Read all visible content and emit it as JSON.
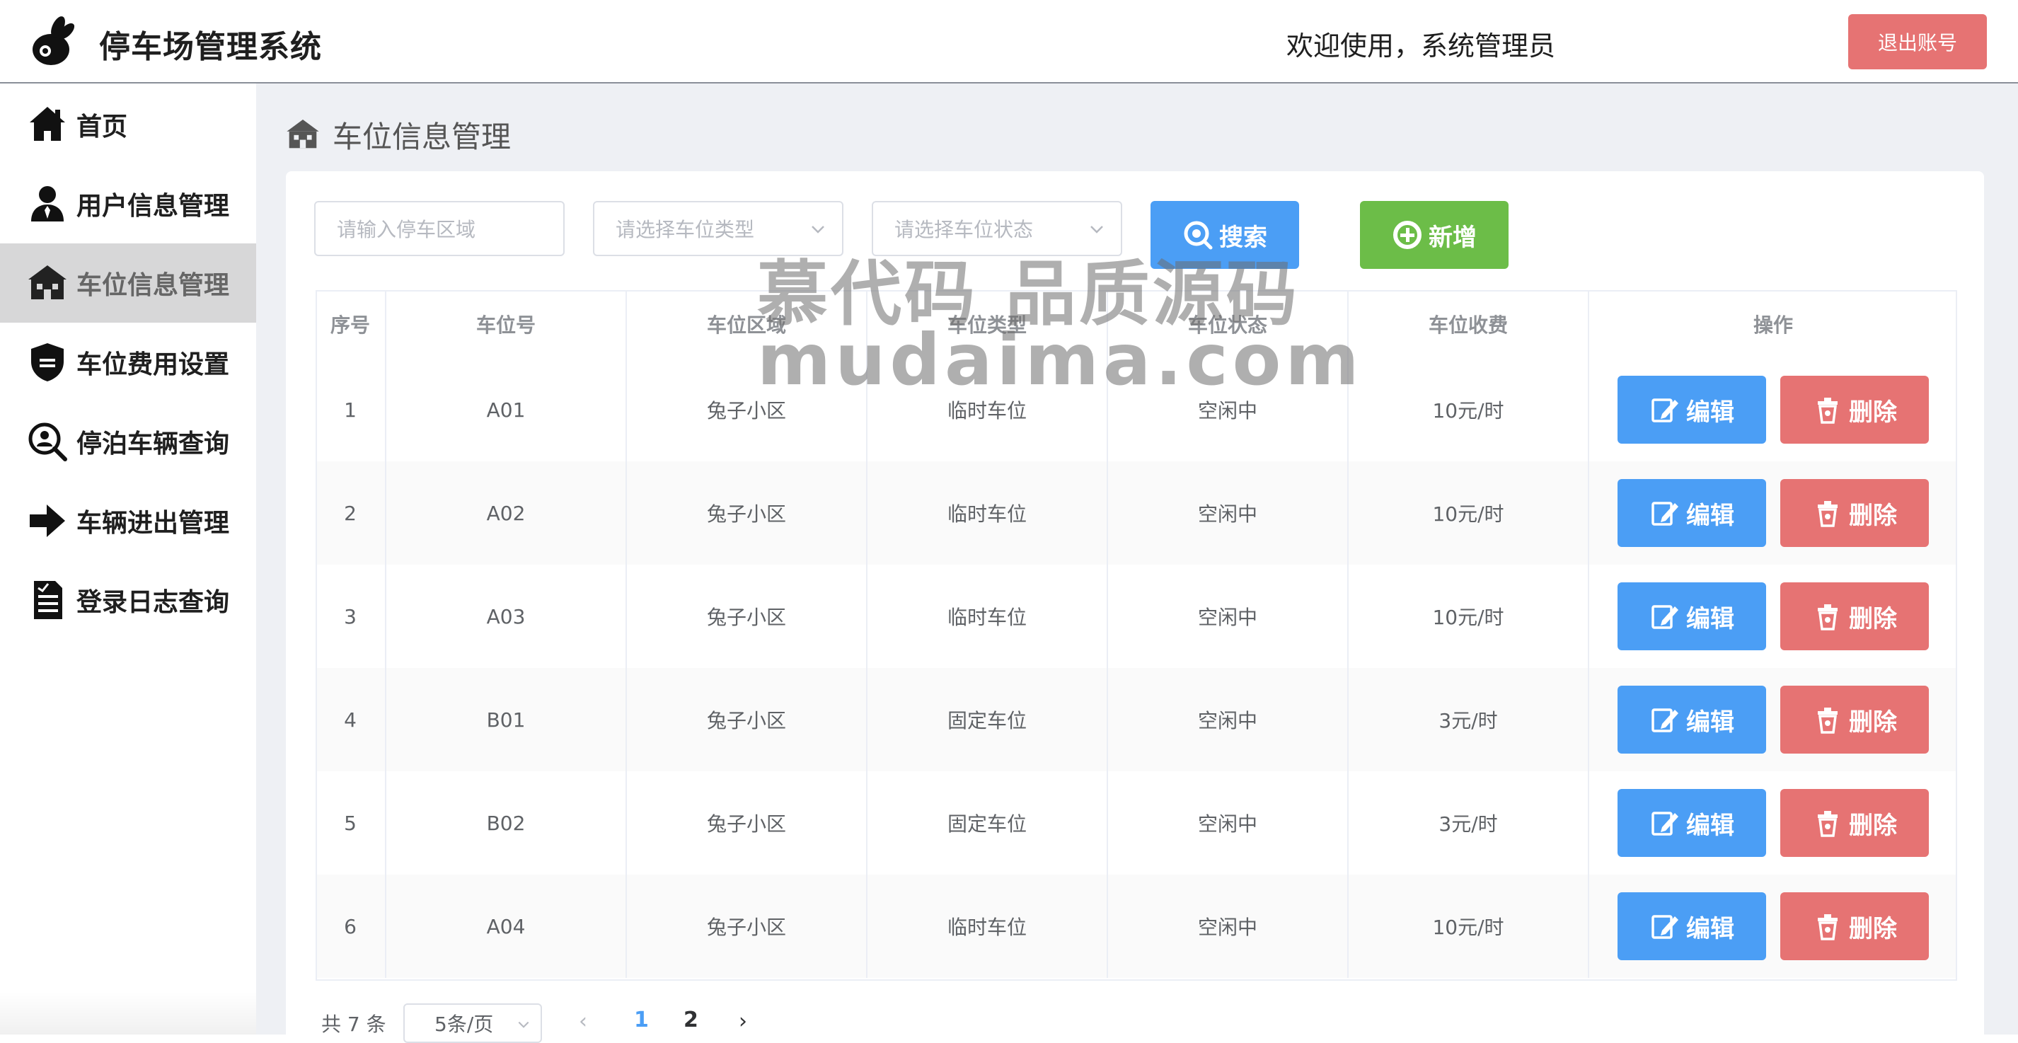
{
  "header": {
    "app_title": "停车场管理系统",
    "welcome": "欢迎使用，系统管理员",
    "logout_label": "退出账号"
  },
  "sidebar": {
    "items": [
      {
        "label": "首页",
        "icon": "home-icon"
      },
      {
        "label": "用户信息管理",
        "icon": "user-icon"
      },
      {
        "label": "车位信息管理",
        "icon": "parking-icon"
      },
      {
        "label": "车位费用设置",
        "icon": "shield-money-icon"
      },
      {
        "label": "停泊车辆查询",
        "icon": "search-person-icon"
      },
      {
        "label": "车辆进出管理",
        "icon": "arrow-right-icon"
      },
      {
        "label": "登录日志查询",
        "icon": "document-icon"
      }
    ],
    "active_index": 2
  },
  "page": {
    "title": "车位信息管理"
  },
  "filters": {
    "area_placeholder": "请输入停车区域",
    "type_placeholder": "请选择车位类型",
    "status_placeholder": "请选择车位状态",
    "search_label": "搜索",
    "add_label": "新增"
  },
  "table": {
    "headers": [
      "序号",
      "车位号",
      "车位区域",
      "车位类型",
      "车位状态",
      "车位收费",
      "操作"
    ],
    "rows": [
      [
        "1",
        "A01",
        "兔子小区",
        "临时车位",
        "空闲中",
        "10元/时"
      ],
      [
        "2",
        "A02",
        "兔子小区",
        "临时车位",
        "空闲中",
        "10元/时"
      ],
      [
        "3",
        "A03",
        "兔子小区",
        "临时车位",
        "空闲中",
        "10元/时"
      ],
      [
        "4",
        "B01",
        "兔子小区",
        "固定车位",
        "空闲中",
        "3元/时"
      ],
      [
        "5",
        "B02",
        "兔子小区",
        "固定车位",
        "空闲中",
        "3元/时"
      ],
      [
        "6",
        "A04",
        "兔子小区",
        "临时车位",
        "空闲中",
        "10元/时"
      ]
    ],
    "edit_label": "编辑",
    "delete_label": "删除"
  },
  "pagination": {
    "total_text": "共 7 条",
    "page_size": "5条/页",
    "pages": [
      "1",
      "2"
    ],
    "current_page": "1",
    "prev": "‹",
    "next": "›"
  },
  "watermark": {
    "line1": "慕代码 品质源码",
    "line2": "mudaima.com"
  },
  "colors": {
    "primary": "#4b9ef5",
    "success": "#6cbd48",
    "danger": "#e67373",
    "active_menu_bg": "#d7d7d8"
  }
}
